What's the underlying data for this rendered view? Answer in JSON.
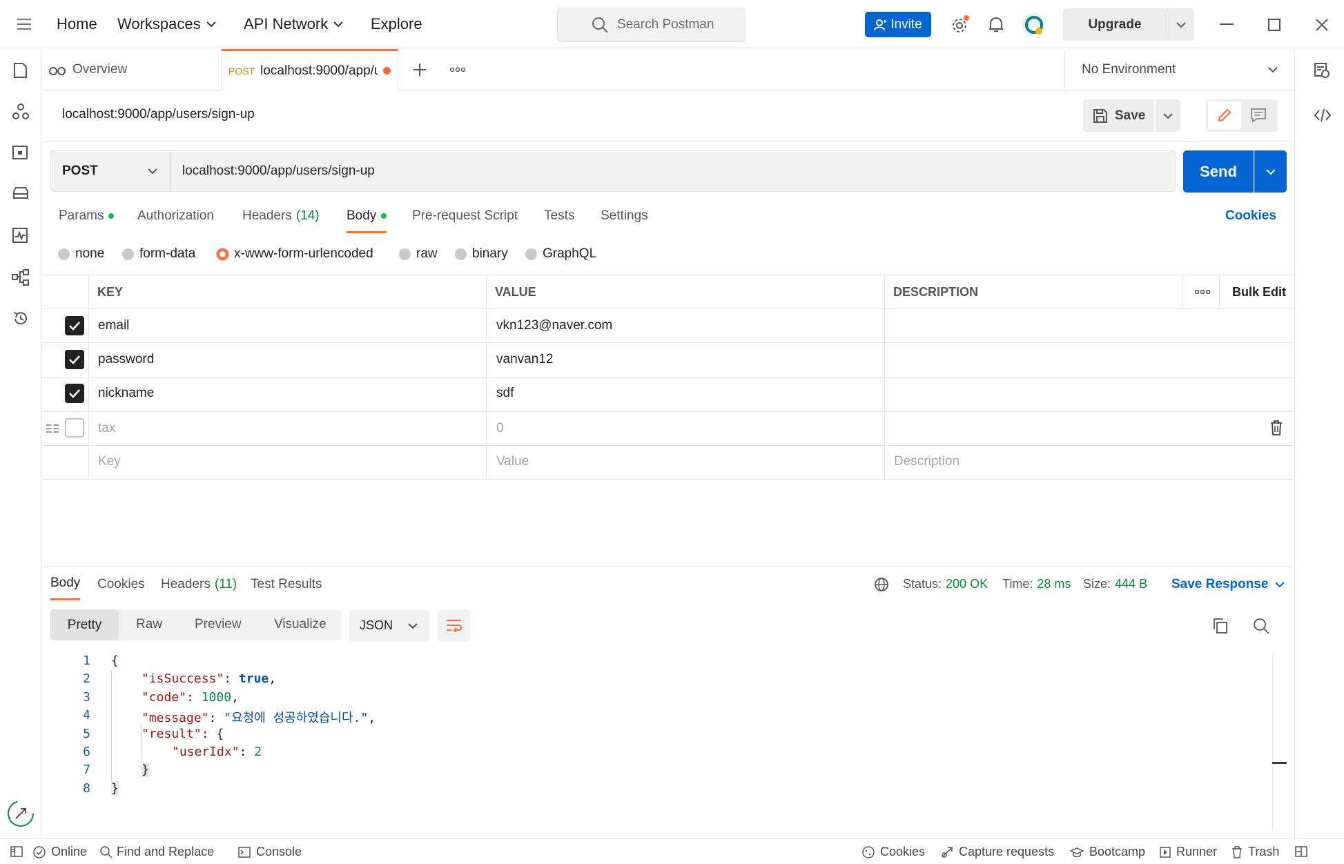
{
  "titlebar": {
    "nav": [
      "Home",
      "Workspaces",
      "API Network",
      "Explore"
    ],
    "search_placeholder": "Search Postman",
    "invite_label": "Invite",
    "upgrade_label": "Upgrade"
  },
  "tabs": {
    "overview_label": "Overview",
    "active_method": "POST",
    "active_label": "localhost:9000/app/u",
    "environment": "No Environment"
  },
  "request": {
    "title": "localhost:9000/app/users/sign-up",
    "save_label": "Save",
    "method": "POST",
    "url": "localhost:9000/app/users/sign-up",
    "send_label": "Send",
    "subtabs": {
      "params": "Params",
      "authorization": "Authorization",
      "headers": "Headers",
      "headers_count": "(14)",
      "body": "Body",
      "prerequest": "Pre-request Script",
      "tests": "Tests",
      "settings": "Settings",
      "cookies": "Cookies"
    },
    "body_types": [
      "none",
      "form-data",
      "x-www-form-urlencoded",
      "raw",
      "binary",
      "GraphQL"
    ],
    "table": {
      "headers": {
        "key": "KEY",
        "value": "VALUE",
        "description": "DESCRIPTION",
        "bulk_edit": "Bulk Edit"
      },
      "rows": [
        {
          "key": "email",
          "value": "vkn123@naver.com",
          "checked": true
        },
        {
          "key": "password",
          "value": "vanvan12",
          "checked": true
        },
        {
          "key": "nickname",
          "value": "sdf",
          "checked": true
        },
        {
          "key": "tax",
          "value": "0",
          "checked": false
        }
      ],
      "placeholder": {
        "key": "Key",
        "value": "Value",
        "description": "Description"
      }
    }
  },
  "response": {
    "tabs": {
      "body": "Body",
      "cookies": "Cookies",
      "headers": "Headers",
      "headers_count": "(11)",
      "test_results": "Test Results"
    },
    "status_label": "Status:",
    "status_value": "200 OK",
    "time_label": "Time:",
    "time_value": "28 ms",
    "size_label": "Size:",
    "size_value": "444 B",
    "save_response": "Save Response",
    "views": [
      "Pretty",
      "Raw",
      "Preview",
      "Visualize"
    ],
    "format": "JSON",
    "code": {
      "line_numbers": [
        "1",
        "2",
        "3",
        "4",
        "5",
        "6",
        "7",
        "8"
      ],
      "open_brace": "{",
      "close_brace": "}",
      "isSuccess_key": "\"isSuccess\"",
      "isSuccess_val": "true",
      "code_key": "\"code\"",
      "code_val": "1000",
      "message_key": "\"message\"",
      "message_val": "\"요청에 성공하였습니다.\"",
      "result_key": "\"result\"",
      "userIdx_key": "\"userIdx\"",
      "userIdx_val": "2"
    }
  },
  "statusbar": {
    "online": "Online",
    "find_replace": "Find and Replace",
    "console": "Console",
    "cookies": "Cookies",
    "capture": "Capture requests",
    "bootcamp": "Bootcamp",
    "runner": "Runner",
    "trash": "Trash"
  },
  "colors": {
    "accent": "#ff6c37",
    "primary": "#0265d2",
    "success": "#0a8a3e"
  }
}
